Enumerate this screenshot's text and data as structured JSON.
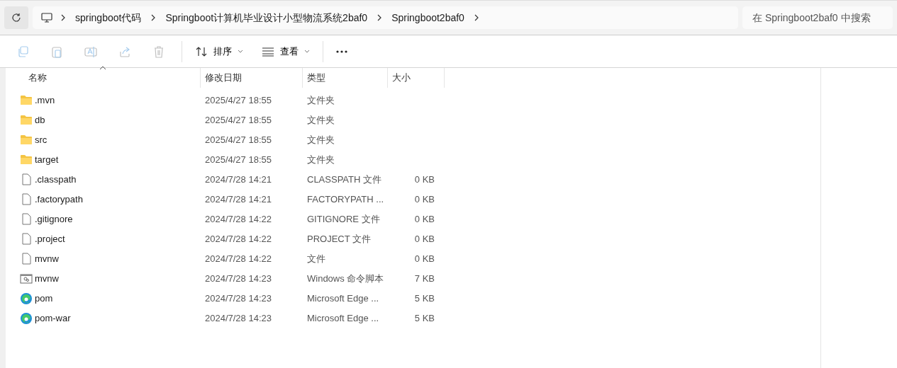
{
  "address_bar": {
    "segments": [
      "springboot代码",
      "Springboot计算机毕业设计小型物流系统2baf0",
      "Springboot2baf0"
    ]
  },
  "search": {
    "placeholder": "在 Springboot2baf0 中搜索"
  },
  "toolbar": {
    "icon_buttons": [
      {
        "kind": "copy",
        "disabled": true
      },
      {
        "kind": "paste",
        "disabled": true
      },
      {
        "kind": "rename",
        "disabled": true
      },
      {
        "kind": "share",
        "disabled": true
      },
      {
        "kind": "delete",
        "disabled": true
      }
    ],
    "sort": {
      "label": "排序"
    },
    "view": {
      "label": "查看"
    }
  },
  "table": {
    "columns": [
      {
        "label": "名称",
        "sorted": true
      },
      {
        "label": "修改日期",
        "sorted": false
      },
      {
        "label": "类型",
        "sorted": false
      },
      {
        "label": "大小",
        "sorted": false
      }
    ],
    "rows": [
      {
        "kind": "folder",
        "name": ".mvn",
        "date": "2025/4/27 18:55",
        "type": "文件夹"
      },
      {
        "kind": "folder",
        "name": "db",
        "date": "2025/4/27 18:55",
        "type": "文件夹"
      },
      {
        "kind": "folder",
        "name": "src",
        "date": "2025/4/27 18:55",
        "type": "文件夹"
      },
      {
        "kind": "folder",
        "name": "target",
        "date": "2025/4/27 18:55",
        "type": "文件夹"
      },
      {
        "kind": "file",
        "name": ".classpath",
        "date": "2024/7/28 14:21",
        "type": "CLASSPATH 文件",
        "size": "0 KB"
      },
      {
        "kind": "file",
        "name": ".factorypath",
        "date": "2024/7/28 14:21",
        "type": "FACTORYPATH ...",
        "size": "0 KB"
      },
      {
        "kind": "file",
        "name": ".gitignore",
        "date": "2024/7/28 14:22",
        "type": "GITIGNORE 文件",
        "size": "0 KB"
      },
      {
        "kind": "file",
        "name": ".project",
        "date": "2024/7/28 14:22",
        "type": "PROJECT 文件",
        "size": "0 KB"
      },
      {
        "kind": "file",
        "name": "mvnw",
        "date": "2024/7/28 14:22",
        "type": "文件",
        "size": "0 KB"
      },
      {
        "kind": "script",
        "name": "mvnw",
        "date": "2024/7/28 14:23",
        "type": "Windows 命令脚本",
        "size": "7 KB"
      },
      {
        "kind": "edge",
        "name": "pom",
        "date": "2024/7/28 14:23",
        "type": "Microsoft Edge ...",
        "size": "5 KB"
      },
      {
        "kind": "edge",
        "name": "pom-war",
        "date": "2024/7/28 14:23",
        "type": "Microsoft Edge ...",
        "size": "5 KB"
      }
    ]
  }
}
